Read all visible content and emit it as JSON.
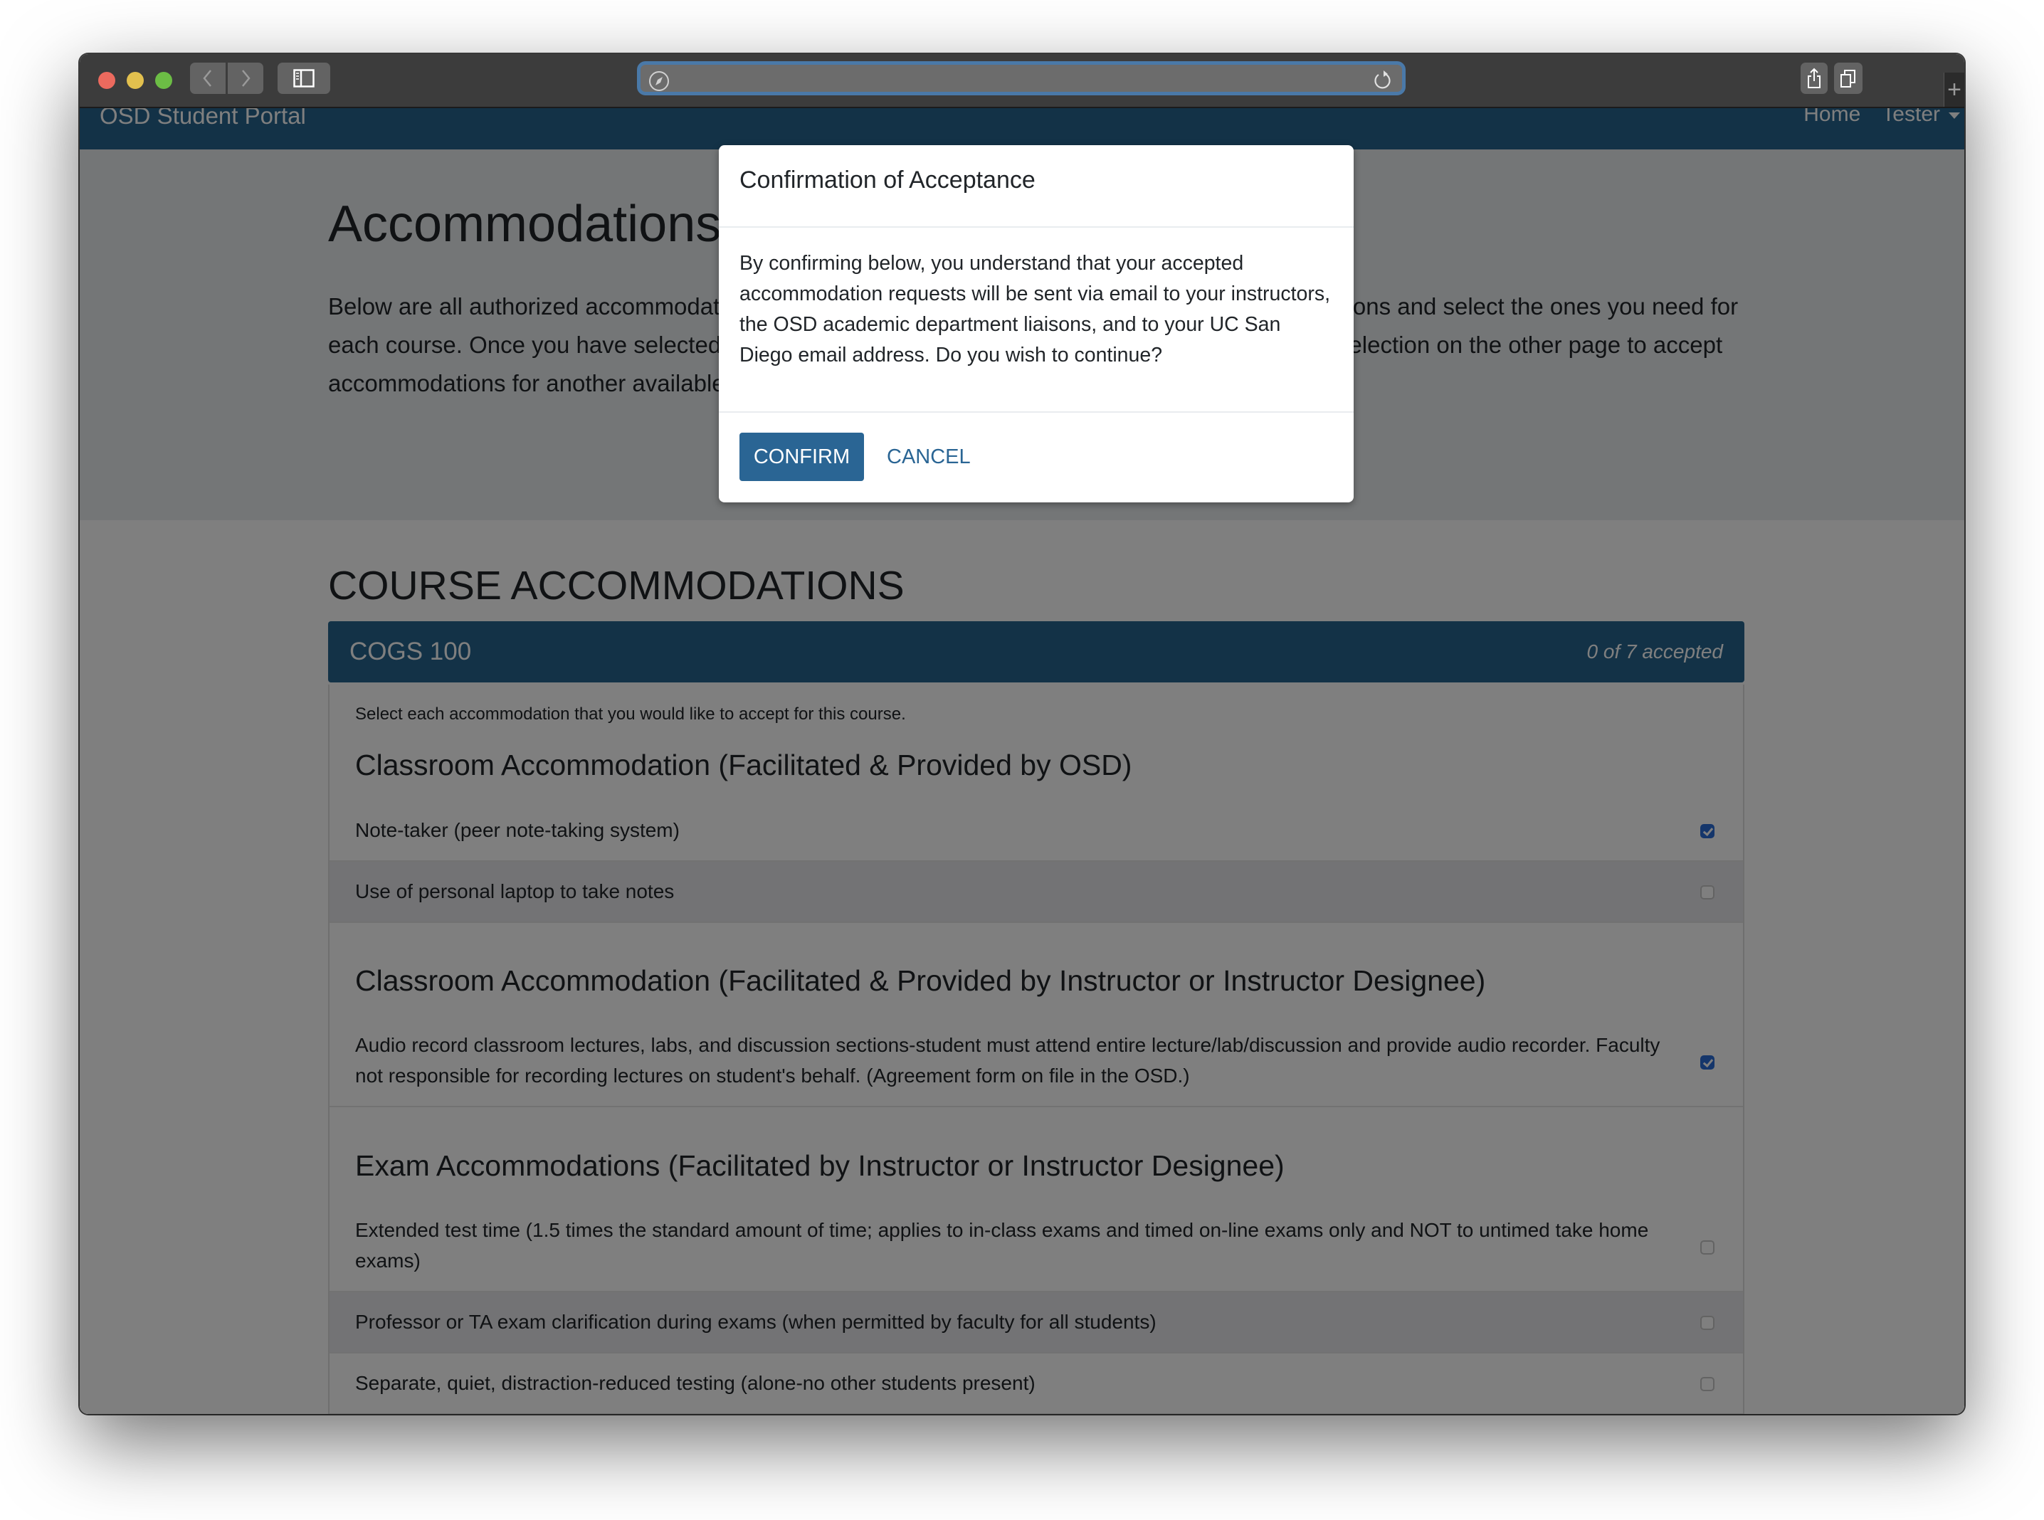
{
  "browser": {
    "url": "",
    "toolbar_icons": [
      "back-icon",
      "forward-icon",
      "sidebar-icon",
      "compass-icon",
      "reload-icon",
      "share-icon",
      "tabs-icon",
      "new-tab-icon"
    ]
  },
  "navbar": {
    "brand": "OSD Student Portal",
    "links": [
      {
        "label": "Home"
      },
      {
        "label": "Tester",
        "has_dropdown": true
      }
    ]
  },
  "jumbotron": {
    "title": "Accommodations",
    "description": "Below are all authorized accommodations for the current quarter. Please review your accommodations and select the ones you need for each course. Once you have selected and confirmed your choices, you may return to the quarter selection on the other page to accept accommodations for another available quarter or click on your name to log out."
  },
  "section_title": "COURSE ACCOMMODATIONS",
  "course": {
    "name": "COGS 100",
    "accepted_status": "0 of 7 accepted",
    "instructions": "Select each accommodation that you would like to accept for this course.",
    "groups": [
      {
        "title": "Classroom Accommodation (Facilitated & Provided by OSD)",
        "items": [
          {
            "label": "Note-taker (peer note-taking system)",
            "checked": true
          },
          {
            "label": "Use of personal laptop to take notes",
            "checked": false
          }
        ]
      },
      {
        "title": "Classroom Accommodation (Facilitated & Provided by Instructor or Instructor Designee)",
        "items": [
          {
            "label": "Audio record classroom lectures, labs, and discussion sections-student must attend entire lecture/lab/discussion and provide audio recorder. Faculty not responsible for recording lectures on student's behalf. (Agreement form on file in the OSD.)",
            "checked": true
          }
        ]
      },
      {
        "title": "Exam Accommodations (Facilitated by Instructor or Instructor Designee)",
        "items": [
          {
            "label": "Extended test time (1.5 times the standard amount of time; applies to in-class exams and timed on-line exams only and NOT to untimed take home exams)",
            "checked": false
          },
          {
            "label": "Professor or TA exam clarification during exams (when permitted by faculty for all students)",
            "checked": false
          },
          {
            "label": "Separate, quiet, distraction-reduced testing (alone-no other students present)",
            "checked": false
          }
        ]
      }
    ]
  },
  "modal": {
    "title": "Confirmation of Acceptance",
    "body": "By confirming below, you understand that your accepted accommodation requests will be sent via email to your instructors, the OSD academic department liaisons, and to your UC San Diego email address. Do you wish to continue?",
    "confirm_label": "CONFIRM",
    "cancel_label": "CANCEL"
  },
  "colors": {
    "brand_blue": "#26658f",
    "button_blue": "#2a6594",
    "checkbox_blue": "#2a6cd6",
    "jumbotron_bg": "#e9ecef"
  }
}
